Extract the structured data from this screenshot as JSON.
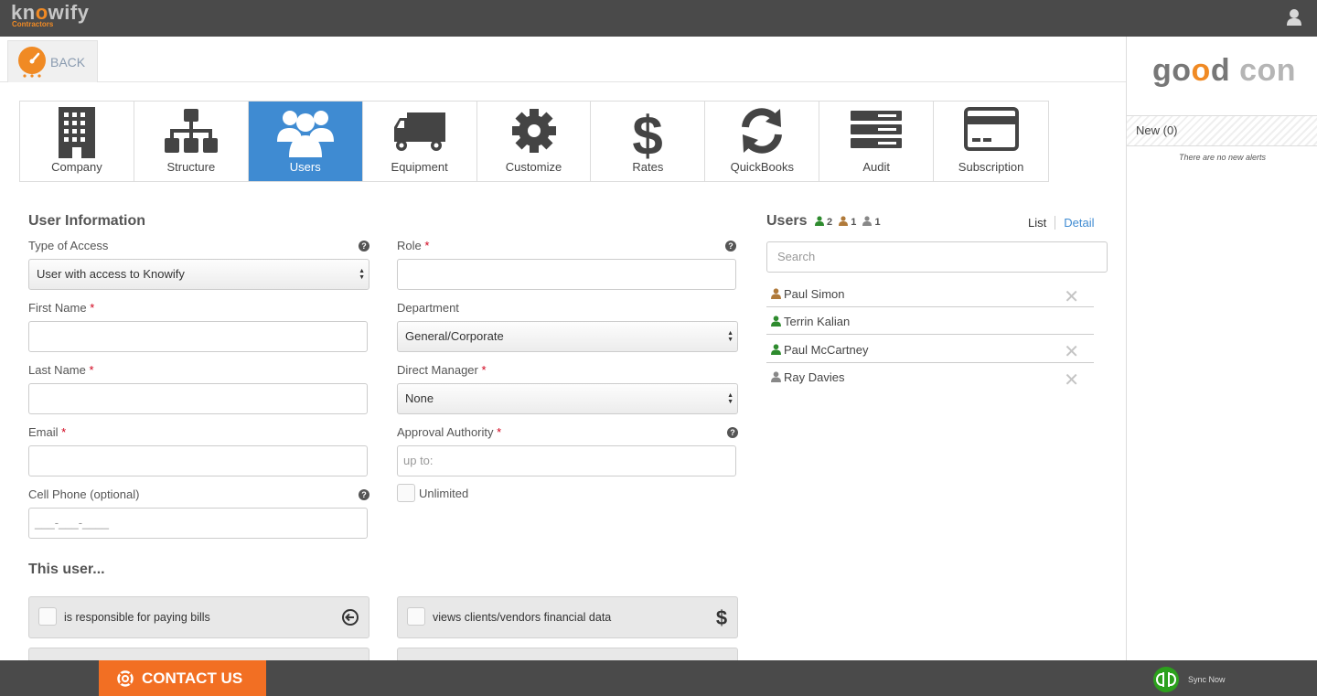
{
  "app": {
    "brand": "knowify",
    "brand_sub": "Contractors"
  },
  "header": {
    "back_label": "BACK"
  },
  "tabs": [
    {
      "label": "Company",
      "icon": "building-icon"
    },
    {
      "label": "Structure",
      "icon": "org-chart-icon"
    },
    {
      "label": "Users",
      "icon": "users-icon",
      "active": true
    },
    {
      "label": "Equipment",
      "icon": "truck-icon"
    },
    {
      "label": "Customize",
      "icon": "gear-icon"
    },
    {
      "label": "Rates",
      "icon": "dollar-icon"
    },
    {
      "label": "QuickBooks",
      "icon": "refresh-icon"
    },
    {
      "label": "Audit",
      "icon": "server-icon"
    },
    {
      "label": "Subscription",
      "icon": "credit-card-icon"
    }
  ],
  "form": {
    "title": "User Information",
    "type_of_access": {
      "label": "Type of Access",
      "value": "User with access to Knowify"
    },
    "role": {
      "label": "Role",
      "req": "*",
      "value": ""
    },
    "first_name": {
      "label": "First Name",
      "req": "*",
      "value": ""
    },
    "department": {
      "label": "Department",
      "value": "General/Corporate"
    },
    "last_name": {
      "label": "Last Name",
      "req": "*",
      "value": ""
    },
    "direct_manager": {
      "label": "Direct Manager",
      "req": "*",
      "value": "None"
    },
    "email": {
      "label": "Email",
      "req": "*",
      "value": ""
    },
    "approval_authority": {
      "label": "Approval Authority",
      "req": "*",
      "placeholder": "up to:"
    },
    "cell_phone": {
      "label": "Cell Phone (optional)",
      "placeholder": "___-___-____"
    },
    "unlimited_label": "Unlimited",
    "help_glyph": "?"
  },
  "this_user": {
    "title": "This user...",
    "permissions": [
      {
        "label": "is responsible for paying bills",
        "icon": "arrow-circle-left-icon"
      },
      {
        "label": "views clients/vendors financial data",
        "icon": "dollar-icon"
      }
    ]
  },
  "users_panel": {
    "title": "Users",
    "counts": [
      {
        "value": "2",
        "color": "#2e8b2e"
      },
      {
        "value": "1",
        "color": "#b07a3a"
      },
      {
        "value": "1",
        "color": "#888888"
      }
    ],
    "list_label": "List",
    "detail_label": "Detail",
    "search_placeholder": "Search",
    "users": [
      {
        "name": "Paul Simon",
        "color": "#b07a3a",
        "removable": true
      },
      {
        "name": "Terrin Kalian",
        "color": "#2e8b2e",
        "removable": false
      },
      {
        "name": "Paul McCartney",
        "color": "#2e8b2e",
        "removable": true
      },
      {
        "name": "Ray Davies",
        "color": "#888888",
        "removable": true
      }
    ],
    "remove_glyph": "✕"
  },
  "alerts": {
    "logo_text": "good con",
    "new_label": "New (0)",
    "empty_text": "There are no new alerts"
  },
  "footer": {
    "contact_label": "CONTACT US",
    "sync_label": "Sync Now"
  }
}
